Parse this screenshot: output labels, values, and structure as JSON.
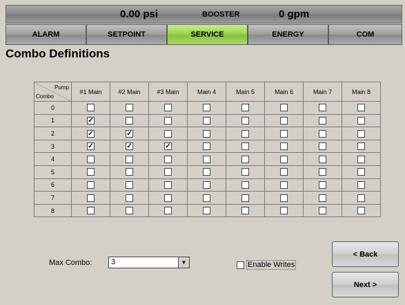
{
  "header": {
    "pressure": "0.00 psi",
    "mode": "BOOSTER",
    "flow": "0 gpm"
  },
  "tabs": [
    {
      "label": "ALARM",
      "active": false
    },
    {
      "label": "SETPOINT",
      "active": false
    },
    {
      "label": "SERVICE",
      "active": true
    },
    {
      "label": "ENERGY",
      "active": false
    },
    {
      "label": "COM",
      "active": false
    }
  ],
  "page_title": "Combo Definitions",
  "grid": {
    "corner_top": "Pump",
    "corner_bottom": "Combo",
    "columns": [
      "#1 Main",
      "#2 Main",
      "#3 Main",
      "Main 4",
      "Main 5",
      "Main 6",
      "Main 7",
      "Main 8"
    ],
    "rows": [
      {
        "label": "0",
        "checks": [
          false,
          false,
          false,
          false,
          false,
          false,
          false,
          false
        ]
      },
      {
        "label": "1",
        "checks": [
          true,
          false,
          false,
          false,
          false,
          false,
          false,
          false
        ]
      },
      {
        "label": "2",
        "checks": [
          true,
          true,
          false,
          false,
          false,
          false,
          false,
          false
        ]
      },
      {
        "label": "3",
        "checks": [
          true,
          true,
          true,
          false,
          false,
          false,
          false,
          false
        ]
      },
      {
        "label": "4",
        "checks": [
          false,
          false,
          false,
          false,
          false,
          false,
          false,
          false
        ]
      },
      {
        "label": "5",
        "checks": [
          false,
          false,
          false,
          false,
          false,
          false,
          false,
          false
        ]
      },
      {
        "label": "6",
        "checks": [
          false,
          false,
          false,
          false,
          false,
          false,
          false,
          false
        ]
      },
      {
        "label": "7",
        "checks": [
          false,
          false,
          false,
          false,
          false,
          false,
          false,
          false
        ]
      },
      {
        "label": "8",
        "checks": [
          false,
          false,
          false,
          false,
          false,
          false,
          false,
          false
        ]
      }
    ]
  },
  "max_combo": {
    "label": "Max Combo:",
    "value": "3",
    "arrow_icon": "chevron-down-icon"
  },
  "enable_writes": {
    "label": "Enable Writes",
    "checked": false
  },
  "buttons": {
    "back": "< Back",
    "next": "Next >"
  },
  "colors": {
    "active_tab": "#99d24c",
    "background": "#d4d0c8"
  }
}
